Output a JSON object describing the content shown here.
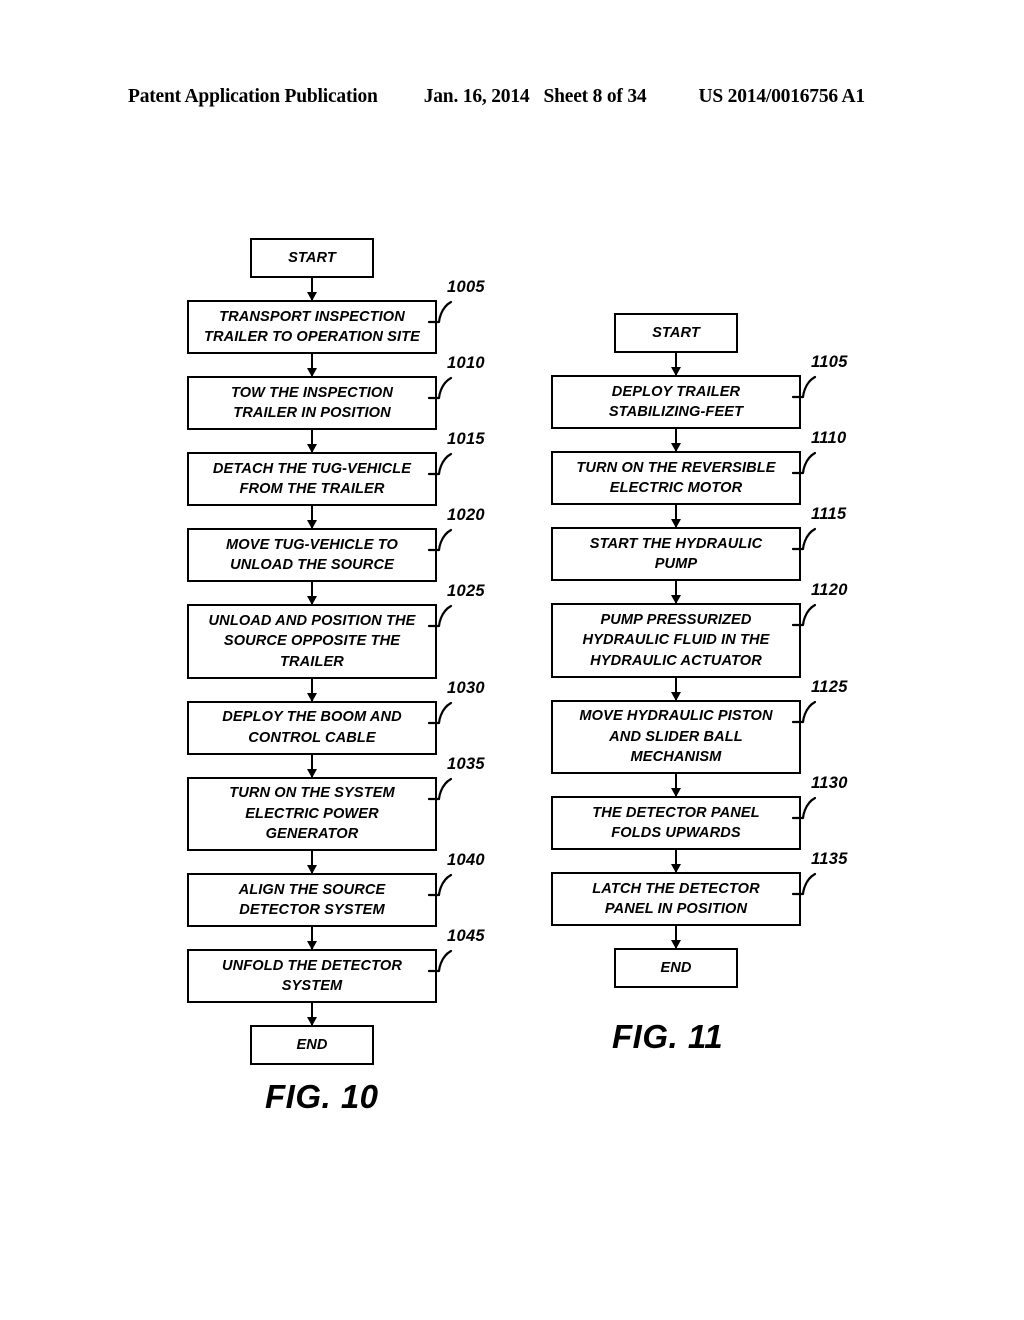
{
  "header": {
    "publication": "Patent Application Publication",
    "date": "Jan. 16, 2014",
    "sheet": "Sheet 8 of 34",
    "patent_number": "US 2014/0016756 A1"
  },
  "figures": [
    {
      "id": "fig-10",
      "caption": "FIG. 10",
      "start_label": "START",
      "end_label": "END",
      "steps": [
        {
          "ref": "1005",
          "text": "TRANSPORT INSPECTION\nTRAILER TO OPERATION SITE"
        },
        {
          "ref": "1010",
          "text": "TOW THE INSPECTION\nTRAILER IN POSITION"
        },
        {
          "ref": "1015",
          "text": "DETACH THE TUG-VEHICLE\nFROM THE TRAILER"
        },
        {
          "ref": "1020",
          "text": "MOVE TUG-VEHICLE TO\nUNLOAD THE SOURCE"
        },
        {
          "ref": "1025",
          "text": "UNLOAD AND POSITION THE\nSOURCE OPPOSITE THE\nTRAILER"
        },
        {
          "ref": "1030",
          "text": "DEPLOY THE BOOM AND\nCONTROL CABLE"
        },
        {
          "ref": "1035",
          "text": "TURN ON THE SYSTEM\nELECTRIC POWER\nGENERATOR"
        },
        {
          "ref": "1040",
          "text": "ALIGN THE SOURCE\nDETECTOR SYSTEM"
        },
        {
          "ref": "1045",
          "text": "UNFOLD THE DETECTOR\nSYSTEM"
        }
      ]
    },
    {
      "id": "fig-11",
      "caption": "FIG. 11",
      "start_label": "START",
      "end_label": "END",
      "steps": [
        {
          "ref": "1105",
          "text": "DEPLOY TRAILER\nSTABILIZING-FEET"
        },
        {
          "ref": "1110",
          "text": "TURN ON THE REVERSIBLE\nELECTRIC MOTOR"
        },
        {
          "ref": "1115",
          "text": "START THE HYDRAULIC\nPUMP"
        },
        {
          "ref": "1120",
          "text": "PUMP PRESSURIZED\nHYDRAULIC FLUID IN THE\nHYDRAULIC ACTUATOR"
        },
        {
          "ref": "1125",
          "text": "MOVE HYDRAULIC PISTON\nAND SLIDER BALL\nMECHANISM"
        },
        {
          "ref": "1130",
          "text": "THE DETECTOR PANEL\nFOLDS UPWARDS"
        },
        {
          "ref": "1135",
          "text": "LATCH THE DETECTOR\nPANEL IN POSITION"
        }
      ]
    }
  ]
}
